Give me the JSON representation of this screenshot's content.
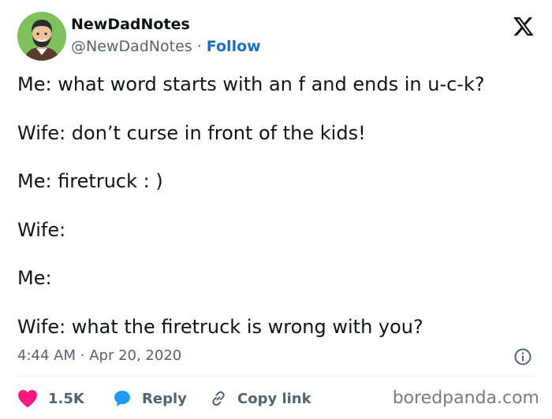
{
  "author": {
    "name": "NewDadNotes",
    "handle": "@NewDadNotes",
    "separator": "·",
    "follow_label": "Follow"
  },
  "tweet": {
    "lines": [
      "Me: what word starts with an f and ends in u-c-k?",
      "Wife: don’t curse in front of the kids!",
      "Me: firetruck : )",
      "Wife:",
      "Me:",
      "Wife: what the firetruck is wrong with you?"
    ],
    "time": "4:44 AM",
    "date_separator": "·",
    "date": "Apr 20, 2020"
  },
  "actions": {
    "likes_count": "1.5K",
    "reply_label": "Reply",
    "copy_link_label": "Copy link"
  },
  "watermark": "boredpanda.com",
  "colors": {
    "text": "#0f1419",
    "muted": "#536471",
    "link": "#1d70b8",
    "heart": "#f91880",
    "reply_bubble": "#1d9bf0",
    "avatar_bg": "#7fc25d"
  },
  "icons": {
    "platform_logo": "x-logo-icon",
    "info": "info-icon",
    "like": "heart-icon",
    "reply": "speech-bubble-icon",
    "copy": "link-icon"
  }
}
